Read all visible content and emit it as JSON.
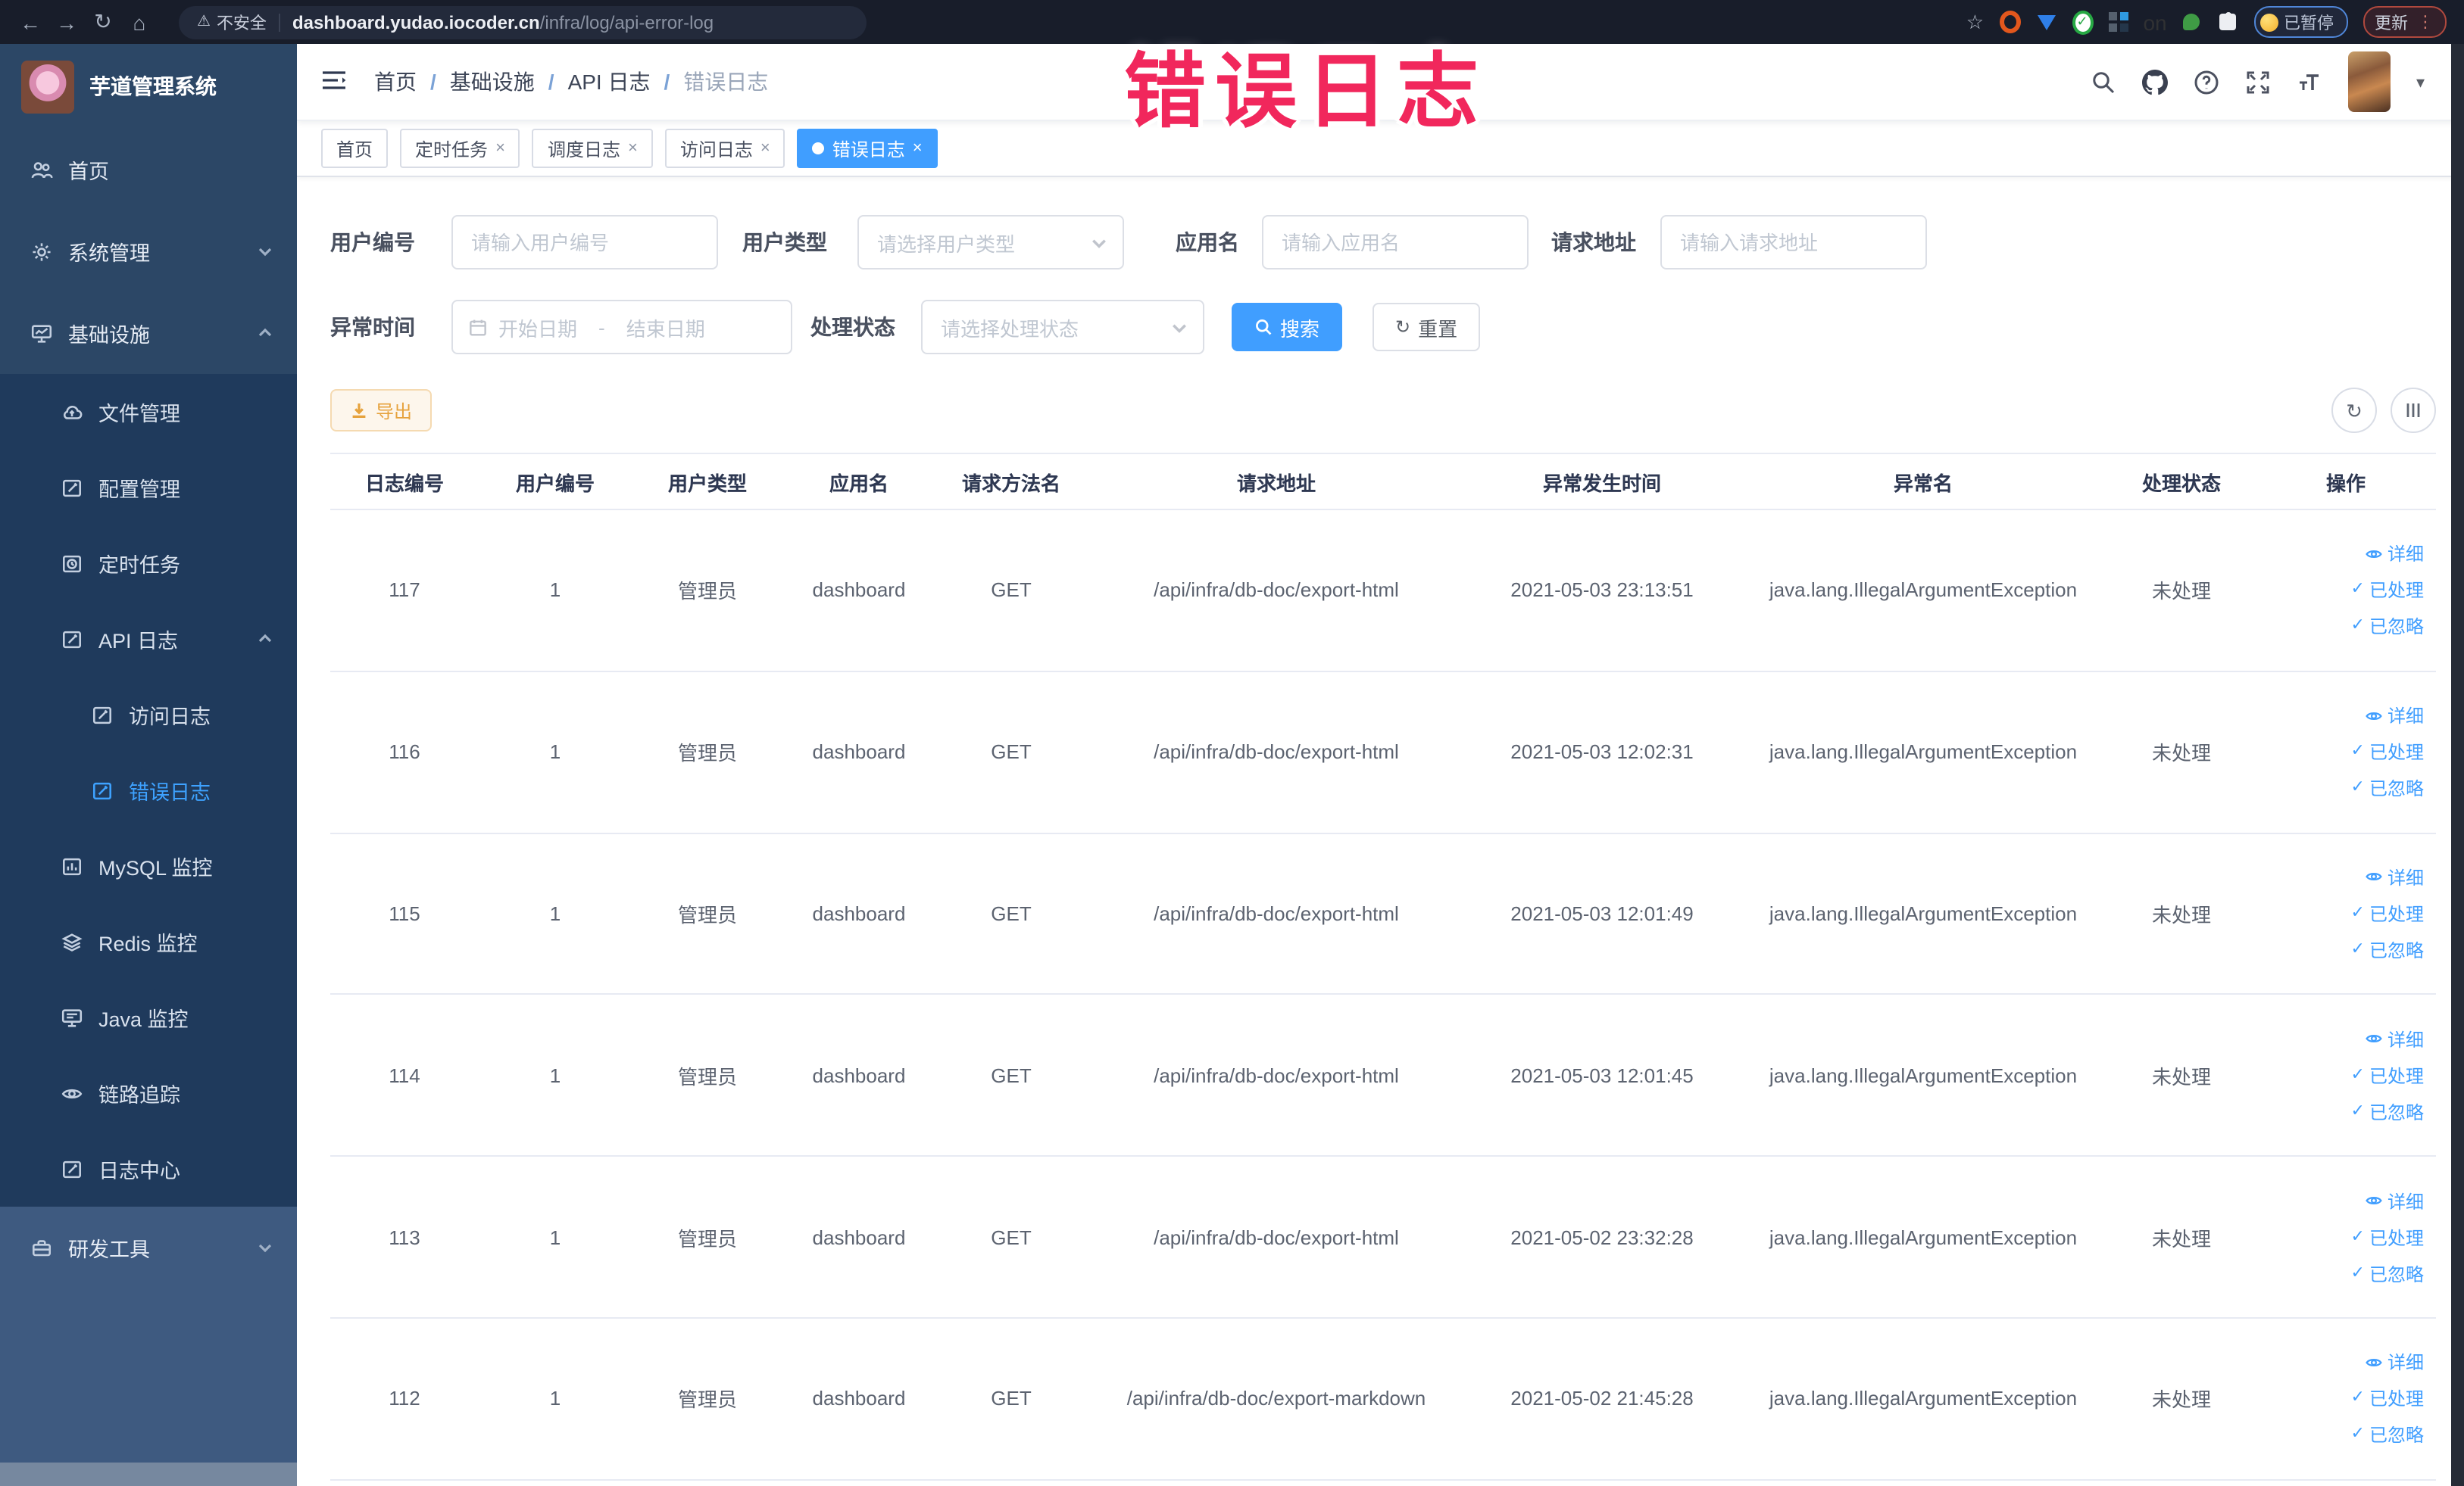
{
  "browser": {
    "security_label": "不安全",
    "url_host": "dashboard.yudao.iocoder.cn",
    "url_path": "/infra/log/api-error-log",
    "extension_on_badge": "on",
    "paused_badge": "已暂停",
    "update_button": "更新"
  },
  "watermark": {
    "text": "错误日志",
    "color": "#F1275C"
  },
  "sidebar": {
    "title": "芋道管理系统",
    "home": "首页",
    "system_mgmt": "系统管理",
    "infrastructure": "基础设施",
    "file_mgmt": "文件管理",
    "config_mgmt": "配置管理",
    "scheduled_jobs": "定时任务",
    "api_log": "API 日志",
    "access_log": "访问日志",
    "error_log": "错误日志",
    "mysql_monitor": "MySQL 监控",
    "redis_monitor": "Redis 监控",
    "java_monitor": "Java 监控",
    "trace": "链路追踪",
    "log_center": "日志中心",
    "dev_tools": "研发工具"
  },
  "navbar": {
    "breadcrumb": [
      "首页",
      "基础设施",
      "API 日志",
      "错误日志"
    ]
  },
  "tags": {
    "items": [
      {
        "label": "首页",
        "active": false,
        "closable": false
      },
      {
        "label": "定时任务",
        "active": false,
        "closable": true
      },
      {
        "label": "调度日志",
        "active": false,
        "closable": true
      },
      {
        "label": "访问日志",
        "active": false,
        "closable": true
      },
      {
        "label": "错误日志",
        "active": true,
        "closable": true
      }
    ]
  },
  "filters": {
    "user_id_label": "用户编号",
    "user_id_placeholder": "请输入用户编号",
    "user_type_label": "用户类型",
    "user_type_placeholder": "请选择用户类型",
    "app_name_label": "应用名",
    "app_name_placeholder": "请输入应用名",
    "request_url_label": "请求地址",
    "request_url_placeholder": "请输入请求地址",
    "exception_time_label": "异常时间",
    "date_start_placeholder": "开始日期",
    "date_range_separator": "-",
    "date_end_placeholder": "结束日期",
    "process_status_label": "处理状态",
    "process_status_placeholder": "请选择处理状态",
    "search_button": "搜索",
    "reset_button": "重置"
  },
  "toolbar": {
    "export_button": "导出"
  },
  "table": {
    "headers": [
      "日志编号",
      "用户编号",
      "用户类型",
      "应用名",
      "请求方法名",
      "请求地址",
      "异常发生时间",
      "异常名",
      "处理状态",
      "操作"
    ],
    "actions": {
      "detail": "详细",
      "processed": "已处理",
      "ignored": "已忽略"
    },
    "rows": [
      {
        "log_id": "117",
        "user_id": "1",
        "user_type": "管理员",
        "app_name": "dashboard",
        "method": "GET",
        "request_url": "/api/infra/db-doc/export-html",
        "time": "2021-05-03 23:13:51",
        "exception_name": "java.lang.IllegalArgumentException",
        "status": "未处理"
      },
      {
        "log_id": "116",
        "user_id": "1",
        "user_type": "管理员",
        "app_name": "dashboard",
        "method": "GET",
        "request_url": "/api/infra/db-doc/export-html",
        "time": "2021-05-03 12:02:31",
        "exception_name": "java.lang.IllegalArgumentException",
        "status": "未处理"
      },
      {
        "log_id": "115",
        "user_id": "1",
        "user_type": "管理员",
        "app_name": "dashboard",
        "method": "GET",
        "request_url": "/api/infra/db-doc/export-html",
        "time": "2021-05-03 12:01:49",
        "exception_name": "java.lang.IllegalArgumentException",
        "status": "未处理"
      },
      {
        "log_id": "114",
        "user_id": "1",
        "user_type": "管理员",
        "app_name": "dashboard",
        "method": "GET",
        "request_url": "/api/infra/db-doc/export-html",
        "time": "2021-05-03 12:01:45",
        "exception_name": "java.lang.IllegalArgumentException",
        "status": "未处理"
      },
      {
        "log_id": "113",
        "user_id": "1",
        "user_type": "管理员",
        "app_name": "dashboard",
        "method": "GET",
        "request_url": "/api/infra/db-doc/export-html",
        "time": "2021-05-02 23:32:28",
        "exception_name": "java.lang.IllegalArgumentException",
        "status": "未处理"
      },
      {
        "log_id": "112",
        "user_id": "1",
        "user_type": "管理员",
        "app_name": "dashboard",
        "method": "GET",
        "request_url": "/api/infra/db-doc/export-markdown",
        "time": "2021-05-02 21:45:28",
        "exception_name": "java.lang.IllegalArgumentException",
        "status": "未处理"
      }
    ]
  },
  "icons": {
    "back": "←",
    "forward": "→",
    "reload": "↻",
    "home": "⌂",
    "warning": "⚠",
    "star": "☆",
    "more_vertical": "⋮",
    "close": "×",
    "check": "✓",
    "caret_down": "▾",
    "refresh": "↻"
  },
  "colors": {
    "accent": "#409EFF",
    "warning": "#E6A23C",
    "watermark_pink": "#F1275C",
    "sidebar_bg": "#2C4766",
    "submenu_bg": "#1F3A5C",
    "chrome_bg": "#181D2A"
  }
}
